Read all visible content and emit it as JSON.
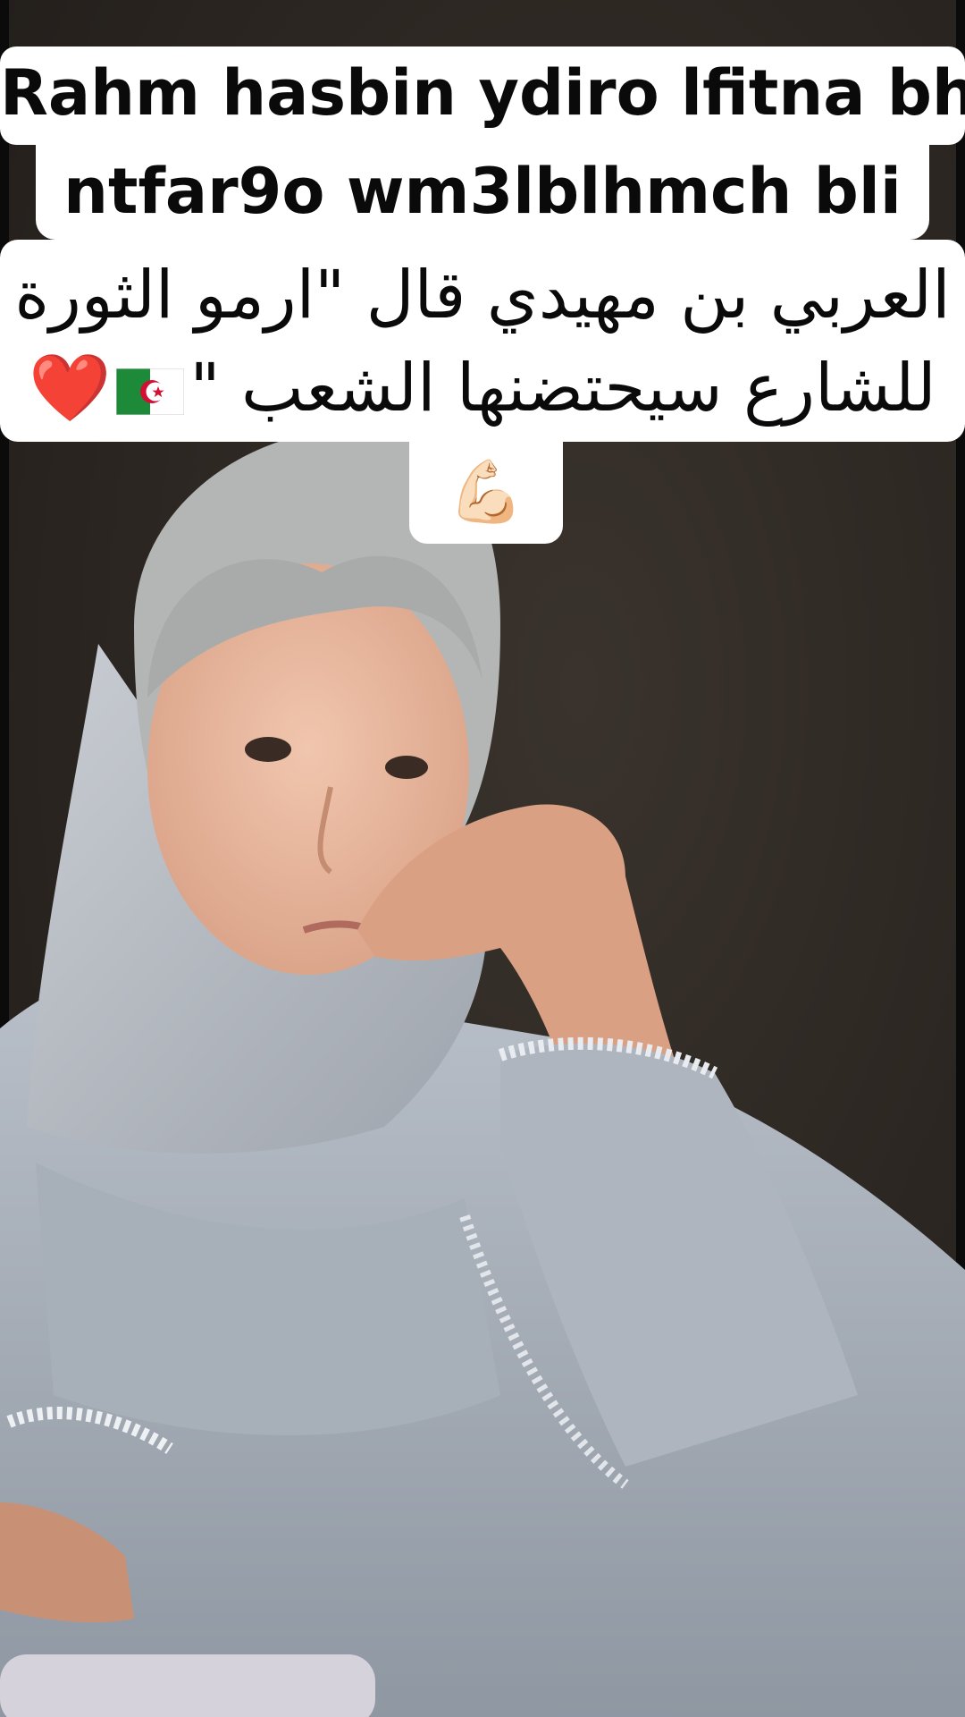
{
  "video": {
    "subject": "person-in-grey-hijab"
  },
  "captions": {
    "line1": "Rahm hasbin ydiro lfitna bh",
    "line2": "ntfar9o wm3lblhmch bli",
    "arabic_line1": "العربي بن مهيدي قال \"ارمو الثورة",
    "arabic_line2_text": "للشارع سيحتضنها الشعب \"",
    "arabic_line2_emoji_heart": "❤️",
    "emoji_flexed_biceps": "💪🏻"
  },
  "colors": {
    "caption_bg": "#ffffff",
    "caption_text": "#0a0a0a",
    "heart": "#e0182a",
    "flag_green": "#1d8a3a",
    "flag_white": "#ffffff",
    "flag_red": "#d21034"
  },
  "icons": [
    "heart-emoji",
    "algeria-flag-icon",
    "flexed-biceps-emoji"
  ]
}
